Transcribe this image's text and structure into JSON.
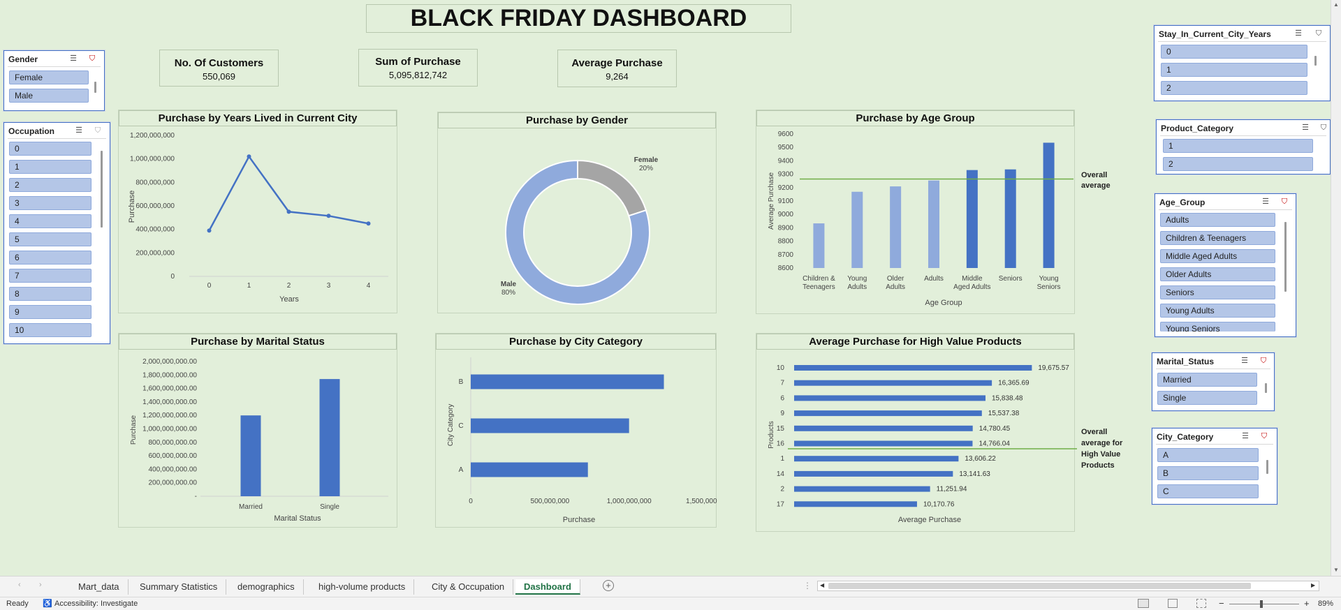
{
  "dashboard_title": "BLACK FRIDAY DASHBOARD",
  "kpis": [
    {
      "label": "No. Of Customers",
      "value": "550,069"
    },
    {
      "label": "Sum of Purchase",
      "value": "5,095,812,742"
    },
    {
      "label": "Average Purchase",
      "value": "9,264"
    }
  ],
  "charts": {
    "years": {
      "title": "Purchase by Years Lived in Current City",
      "xlabel": "Years",
      "ylabel": "Purchase"
    },
    "gender": {
      "title": "Purchase by Gender"
    },
    "age": {
      "title": "Purchase by Age Group",
      "xlabel": "Age Group",
      "ylabel": "Average Purchase",
      "annotation": "Overall average"
    },
    "marital": {
      "title": "Purchase by Marital Status",
      "xlabel": "Marital Status",
      "ylabel": "Purchase"
    },
    "city": {
      "title": "Purchase by City Category",
      "xlabel": "Purchase",
      "ylabel": "City Category"
    },
    "hv": {
      "title": "Average Purchase for High Value Products",
      "xlabel": "Average Purchase",
      "ylabel": "Products",
      "annotation": "Overall average for High Value Products"
    }
  },
  "chart_data": [
    {
      "type": "line",
      "title": "Purchase by Years Lived in Current City",
      "xlabel": "Years",
      "ylabel": "Purchase",
      "x": [
        "0",
        "1",
        "2",
        "3",
        "4"
      ],
      "values": [
        390000000,
        1020000000,
        550000000,
        515000000,
        450000000
      ],
      "ylim": [
        0,
        1200000000
      ],
      "yticks": [
        "0",
        "200,000,000",
        "400,000,000",
        "600,000,000",
        "800,000,000",
        "1,000,000,000",
        "1,200,000,000"
      ]
    },
    {
      "type": "pie",
      "title": "Purchase by Gender",
      "categories": [
        "Female",
        "Male"
      ],
      "values": [
        20,
        80
      ],
      "labels": [
        "Female",
        "Male"
      ],
      "pct_labels": [
        "20%",
        "80%"
      ]
    },
    {
      "type": "bar",
      "title": "Purchase by Age Group",
      "xlabel": "Age Group",
      "ylabel": "Average Purchase",
      "categories": [
        "Children & Teenagers",
        "Young Adults",
        "Older Adults",
        "Adults",
        "Middle Aged Adults",
        "Seniors",
        "Young Seniors"
      ],
      "values": [
        8933,
        9169,
        9209,
        9253,
        9331,
        9336,
        9535
      ],
      "overall_average": 9264,
      "ylim": [
        8600,
        9600
      ],
      "yticks": [
        "8600",
        "8700",
        "8800",
        "8900",
        "9000",
        "9100",
        "9200",
        "9300",
        "9400",
        "9500",
        "9600"
      ]
    },
    {
      "type": "bar",
      "title": "Purchase by Marital Status",
      "xlabel": "Marital Status",
      "ylabel": "Purchase",
      "categories": [
        "Married",
        "Single"
      ],
      "values": [
        1200000000,
        1740000000
      ],
      "ylim": [
        0,
        2000000000
      ],
      "yticks": [
        "-",
        "200,000,000.00",
        "400,000,000.00",
        "600,000,000.00",
        "800,000,000.00",
        "1,000,000,000.00",
        "1,200,000,000.00",
        "1,400,000,000.00",
        "1,600,000,000.00",
        "1,800,000,000.00",
        "2,000,000,000.00"
      ]
    },
    {
      "type": "bar",
      "orientation": "horizontal",
      "title": "Purchase by City Category",
      "xlabel": "Purchase",
      "ylabel": "City Category",
      "categories": [
        "B",
        "C",
        "A"
      ],
      "values": [
        1220000000,
        1000000000,
        740000000
      ],
      "xlim": [
        0,
        1500000000
      ],
      "xticks": [
        "0",
        "500,000,000",
        "1,000,000,000",
        "1,500,000,000"
      ]
    },
    {
      "type": "bar",
      "orientation": "horizontal",
      "title": "Average Purchase for High Value Products",
      "xlabel": "Average Purchase",
      "ylabel": "Products",
      "categories": [
        "10",
        "7",
        "6",
        "9",
        "15",
        "16",
        "1",
        "14",
        "2",
        "17"
      ],
      "values": [
        19675.57,
        16365.69,
        15838.48,
        15537.38,
        14780.45,
        14766.04,
        13606.22,
        13141.63,
        11251.94,
        10170.76
      ],
      "labels": [
        "19,675.57",
        "16,365.69",
        "15,838.48",
        "15,537.38",
        "14,780.45",
        "14,766.04",
        "13,606.22",
        "13,141.63",
        "11,251.94",
        "10,170.76"
      ],
      "xlim": [
        0,
        20000
      ]
    }
  ],
  "slicers": {
    "gender": {
      "title": "Gender",
      "items": [
        "Female",
        "Male"
      ]
    },
    "occupation": {
      "title": "Occupation",
      "items": [
        "0",
        "1",
        "2",
        "3",
        "4",
        "5",
        "6",
        "7",
        "8",
        "9",
        "10"
      ]
    },
    "stay": {
      "title": "Stay_In_Current_City_Years",
      "items": [
        "0",
        "1",
        "2"
      ]
    },
    "product": {
      "title": "Product_Category",
      "items": [
        "1",
        "2"
      ]
    },
    "age": {
      "title": "Age_Group",
      "items": [
        "Adults",
        "Children & Teenagers",
        "Middle Aged Adults",
        "Older Adults",
        "Seniors",
        "Young Adults",
        "Young Seniors"
      ]
    },
    "marital": {
      "title": "Marital_Status",
      "items": [
        "Married",
        "Single"
      ]
    },
    "city": {
      "title": "City_Category",
      "items": [
        "A",
        "B",
        "C"
      ]
    }
  },
  "sheet_tabs": [
    "Mart_data",
    "Summary Statistics",
    "demographics",
    "high-volume products",
    "City & Occupation",
    "Dashboard"
  ],
  "active_tab": "Dashboard",
  "status": {
    "ready": "Ready",
    "accessibility": "Accessibility: Investigate",
    "zoom": "89%"
  },
  "colors": {
    "bar_light": "#8faadc",
    "bar_dark": "#4472c4",
    "line": "#4472c4",
    "female": "#a5a5a5",
    "avg_line": "#70ad47",
    "background": "#e2efda"
  },
  "icons": [
    "multi-select-icon",
    "clear-filter-icon",
    "add-sheet-icon",
    "accessibility-icon",
    "normal-view-icon",
    "page-layout-icon",
    "page-break-icon"
  ]
}
